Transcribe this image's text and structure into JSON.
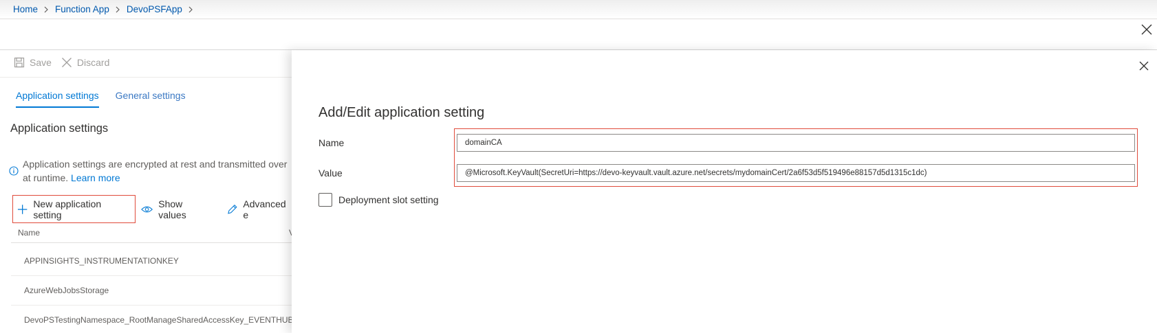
{
  "breadcrumb": {
    "items": [
      "Home",
      "Function App",
      "DevoPSFApp"
    ]
  },
  "commandbar": {
    "save_label": "Save",
    "discard_label": "Discard"
  },
  "tabs": [
    {
      "label": "Application settings"
    },
    {
      "label": "General settings"
    }
  ],
  "section": {
    "title": "Application settings",
    "info_text": "Application settings are encrypted at rest and transmitted over",
    "info_text_2": "at runtime.",
    "learn_more": "Learn more"
  },
  "actions": {
    "new_setting": "New application setting",
    "show_values": "Show values",
    "advanced": "Advanced e"
  },
  "table": {
    "name_header": "Name",
    "value_header": "V",
    "rows": [
      "APPINSIGHTS_INSTRUMENTATIONKEY",
      "AzureWebJobsStorage",
      "DevoPSTestingNamespace_RootManageSharedAccessKey_EVENTHUB"
    ]
  },
  "panel": {
    "title": "Add/Edit application setting",
    "name_label": "Name",
    "name_value": "domainCA",
    "value_label": "Value",
    "value_value": "@Microsoft.KeyVault(SecretUri=https://devo-keyvault.vault.azure.net/secrets/mydomainCert/2a6f53d5f519496e88157d5d1315c1dc)",
    "slot_setting_label": "Deployment slot setting"
  },
  "colors": {
    "accent": "#0078d4",
    "link": "#0058ad",
    "highlight": "#e04a3a"
  }
}
